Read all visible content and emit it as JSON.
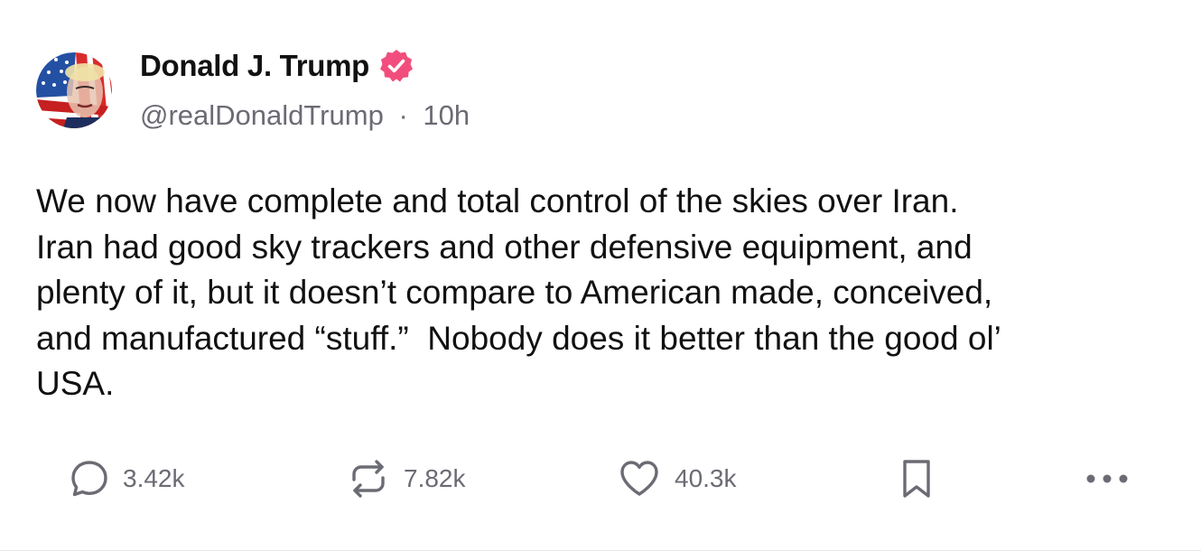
{
  "post": {
    "author": {
      "display_name": "Donald J. Trump",
      "verified": true,
      "verified_icon": "verified-badge-icon",
      "handle": "@realDonaldTrump",
      "separator": "·",
      "time_ago": "10h"
    },
    "body_lines": [
      "We now have complete and total control of the skies over Iran.",
      "Iran had good sky trackers and other defensive equipment, and",
      "plenty of it, but it doesn’t compare to American made, conceived,",
      "and manufactured “stuff.”  Nobody does it better than the good ol’",
      "USA."
    ],
    "actions": {
      "reply": {
        "icon": "reply-bubble-icon",
        "count": "3.42k"
      },
      "repost": {
        "icon": "repost-icon",
        "count": "7.82k"
      },
      "like": {
        "icon": "heart-icon",
        "count": "40.3k"
      },
      "bookmark": {
        "icon": "bookmark-icon"
      },
      "more": {
        "icon": "more-dots-icon"
      }
    }
  },
  "colors": {
    "text_primary": "#111111",
    "text_secondary": "#6b6b74",
    "verified_badge": "#f24e7d",
    "background": "#ffffff"
  }
}
